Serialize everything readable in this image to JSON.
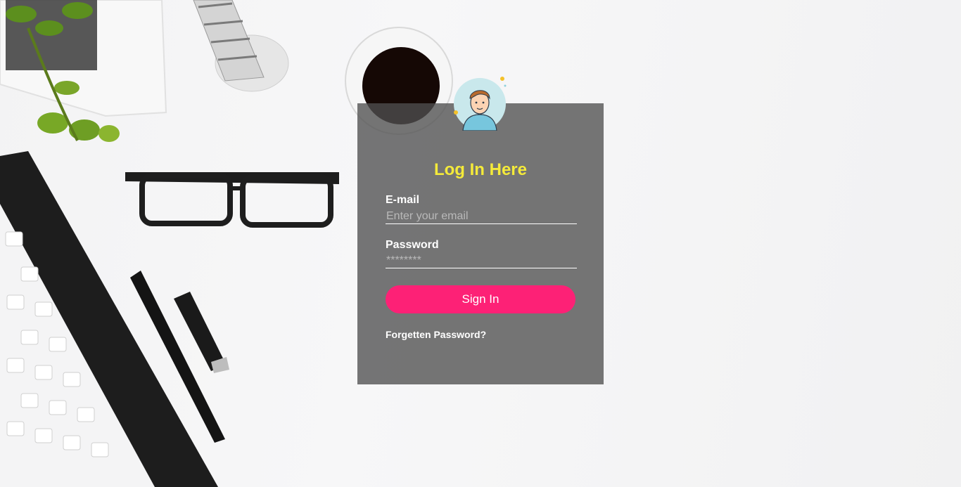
{
  "login": {
    "title": "Log In Here",
    "email_label": "E-mail",
    "email_placeholder": "Enter your email",
    "password_label": "Password",
    "password_placeholder": "********",
    "signin_label": "Sign In",
    "forgot_label": "Forgetten Password?"
  },
  "icons": {
    "avatar": "user-avatar-icon"
  },
  "colors": {
    "title": "#f4ea3a",
    "button": "#fd2176",
    "panel": "rgba(80,80,80,0.78)"
  }
}
